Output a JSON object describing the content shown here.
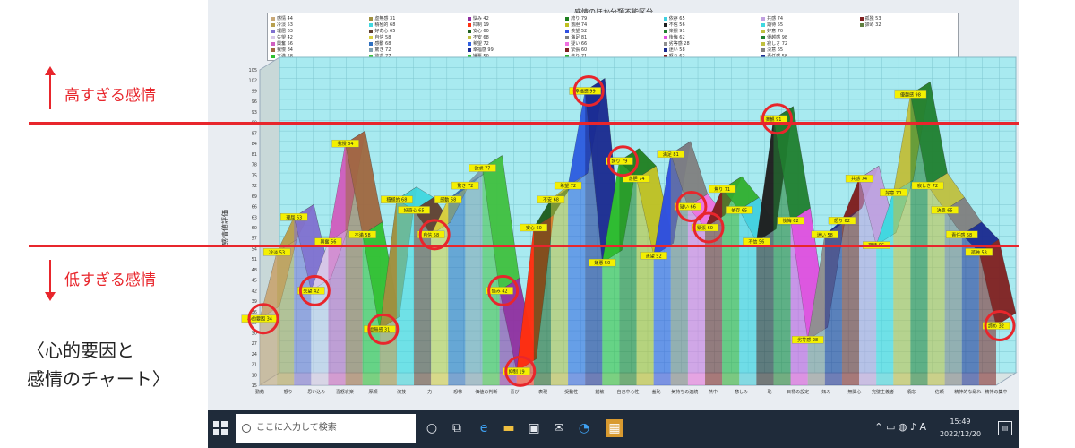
{
  "annotations": {
    "high_label": "高すぎる感情",
    "low_label": "低すぎる感情",
    "caption": "〈心的要因と\n感情のチャート〉",
    "accent_color": "#e8262c"
  },
  "taskbar": {
    "search_placeholder": "ここに入力して検索",
    "time": "15:49",
    "date": "2022/12/20",
    "ime": "A",
    "icons": [
      "windows-icon",
      "search-icon",
      "cortana-icon",
      "task-view-icon",
      "edge-icon",
      "file-explorer-icon",
      "store-icon",
      "mail-icon",
      "app-icon",
      "active-app-icon"
    ]
  },
  "chart_data": {
    "type": "area",
    "title": "感情のほか分類不能区分",
    "ylabel": "感情値評価",
    "ylim": [
      15,
      105
    ],
    "grid": true,
    "categories": [
      "勤勉",
      "怒り",
      "思い込み",
      "喜怒哀楽",
      "厚顔",
      "演技",
      "力",
      "恐怖",
      "価値の判断",
      "喜び",
      "表現",
      "受動性",
      "鋭敏",
      "自己中心性",
      "羞恥",
      "気持ちの連続",
      "熱中",
      "悲しみ",
      "恥",
      "目標の設定",
      "妬み",
      "無関心",
      "完璧主義者",
      "順応",
      "信頼",
      "精神的な乱れ",
      "精神の集中"
    ],
    "values": [
      34,
      53,
      63,
      42,
      56,
      84,
      58,
      31,
      68,
      65,
      58,
      68,
      72,
      77,
      42,
      19,
      60,
      68,
      72,
      99,
      50,
      79,
      74,
      52,
      81,
      66,
      60,
      71,
      65,
      56,
      91,
      62,
      28,
      58,
      62,
      74,
      55,
      70,
      98,
      72,
      65,
      58,
      53,
      32
    ],
    "colors": [
      "#c8a878",
      "#b8a050",
      "#8070d0",
      "#d8c8e8",
      "#d060c0",
      "#a06840",
      "#30c030",
      "#a09040",
      "#40d8e0",
      "#604030",
      "#d8d040",
      "#3070c0",
      "#80a0b0",
      "#40c040",
      "#9030a0",
      "#ff3010",
      "#206020",
      "#c0c040",
      "#3060e0",
      "#1a2a90",
      "#30c030",
      "#208020",
      "#c0c020",
      "#3050e0",
      "#808080",
      "#f070e0",
      "#802020",
      "#30b030",
      "#40d0e0",
      "#202020",
      "#208030",
      "#e050e0",
      "#909090",
      "#1a2a90",
      "#802020",
      "#c0a0e0",
      "#40d8e0",
      "#c0c040",
      "#208030",
      "#c0c040",
      "#808080",
      "#1a2a90",
      "#802020",
      "#608040"
    ],
    "data_labels": [
      "心的要因",
      "冷淡",
      "理屈",
      "失望",
      "興奮",
      "我慢",
      "不満",
      "虚無感",
      "積極的",
      "好奇心",
      "自信",
      "感動",
      "驚き",
      "欲求",
      "悩み",
      "抑制",
      "安心",
      "不安",
      "希望",
      "幸福感",
      "嫌悪",
      "誇り",
      "落胆",
      "羨望",
      "満足",
      "疑い",
      "緊張",
      "焦り",
      "依存",
      "不信",
      "楽観",
      "後悔",
      "劣等感",
      "迷い",
      "怒り",
      "共感",
      "期待",
      "好意",
      "優越感",
      "寂しさ",
      "決意",
      "責任感",
      "孤独",
      "諦め"
    ],
    "legend_entries": [
      "感情 44",
      "冷淡 53",
      "理屈 63",
      "失望 42",
      "興奮 56",
      "我慢 84",
      "不満 58",
      "虚無感 31",
      "積極的 68",
      "好奇心 65",
      "自信 58",
      "感動 68",
      "驚き 72",
      "欲求 77",
      "悩み 42",
      "抑制 19",
      "安心 60",
      "不安 68",
      "希望 72",
      "幸福感 99",
      "嫌悪 50",
      "誇り 79",
      "落胆 74",
      "羨望 52",
      "満足 81",
      "疑い 66",
      "緊張 60",
      "焦り 71",
      "依存 65",
      "不信 56",
      "楽観 91",
      "後悔 62",
      "劣等感 28",
      "迷い 58",
      "怒り 62",
      "共感 74",
      "期待 55",
      "好意 70",
      "優越感 98",
      "寂しさ 72",
      "決意 65",
      "責任感 58",
      "孤独 53",
      "諦め 32"
    ],
    "threshold_high": 90,
    "threshold_low": 55,
    "circled_points": [
      0,
      3,
      7,
      10,
      14,
      15,
      19,
      21,
      25,
      26,
      30,
      43
    ]
  }
}
